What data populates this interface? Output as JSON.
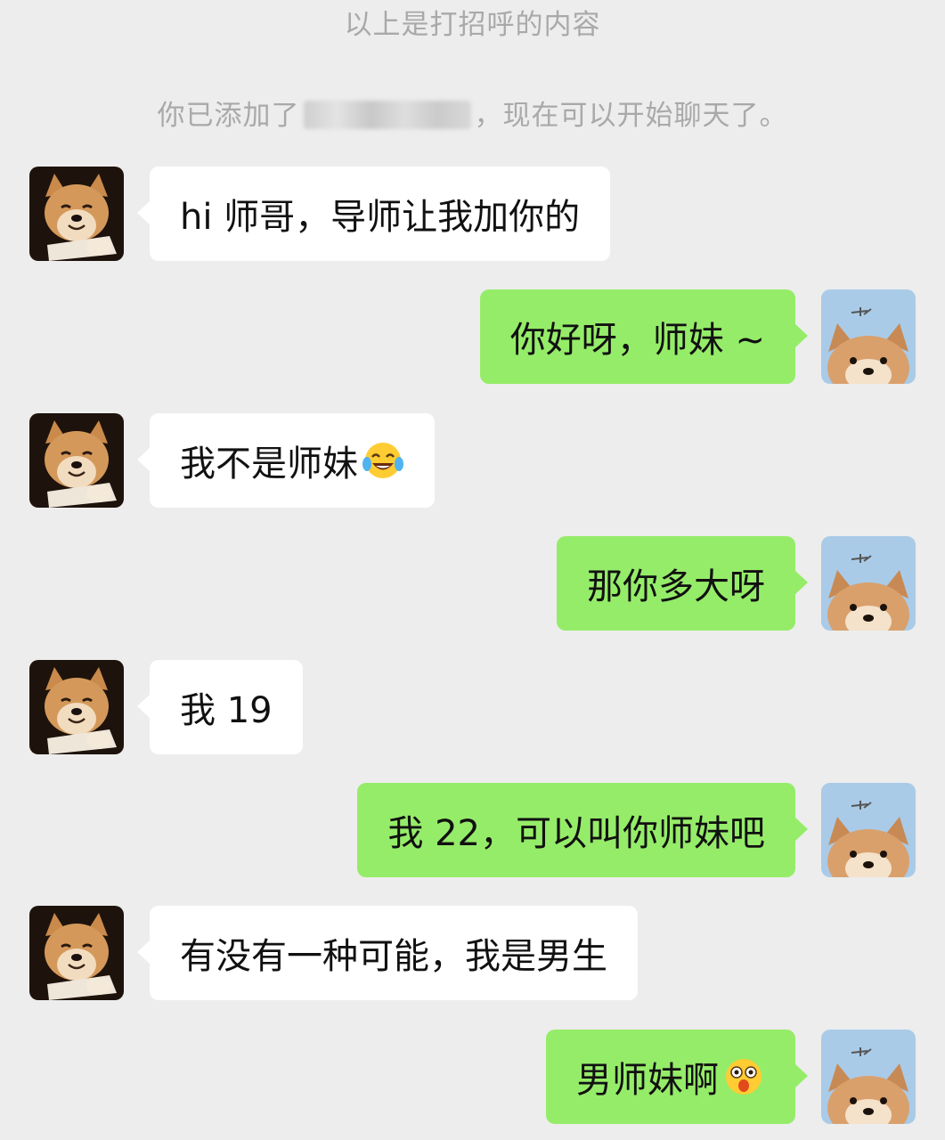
{
  "system_messages": {
    "greeting_end": "以上是打招呼的内容",
    "added_prefix": "你已添加了",
    "added_suffix": "，现在可以开始聊天了。"
  },
  "avatars": {
    "left": "shiba-smiling-avatar",
    "right": "shiba-peeking-avatar"
  },
  "colors": {
    "background": "#ededed",
    "incoming_bubble": "#ffffff",
    "outgoing_bubble": "#95ec69",
    "system_text": "#a9a9a9"
  },
  "messages": [
    {
      "side": "left",
      "text": "hi 师哥，导师让我加你的"
    },
    {
      "side": "right",
      "text": "你好呀，师妹 ~"
    },
    {
      "side": "left",
      "text": "我不是师妹",
      "emoji": "laughing-tears-emoji"
    },
    {
      "side": "right",
      "text": "那你多大呀"
    },
    {
      "side": "left",
      "text": "我 19"
    },
    {
      "side": "right",
      "text": "我 22，可以叫你师妹吧"
    },
    {
      "side": "left",
      "text": "有没有一种可能，我是男生"
    },
    {
      "side": "right",
      "text": "男师妹啊",
      "emoji": "shocked-face-emoji"
    }
  ]
}
